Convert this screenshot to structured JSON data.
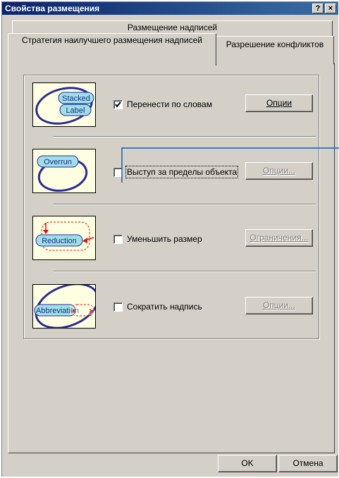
{
  "window": {
    "title": "Свойства размещения",
    "help_button": "?",
    "close_button": "×"
  },
  "tabs": {
    "back_row": [
      "Размещение надписей"
    ],
    "front_row": [
      "Стратегия наилучшего размещения надписей",
      "Разрешение конфликтов"
    ],
    "active": "Стратегия наилучшего размещения надписей"
  },
  "options": [
    {
      "illustration": [
        "Stacked",
        "Label"
      ],
      "checkbox_label": "Перенести по словам",
      "checked": true,
      "button_label": "Опции",
      "button_enabled": true
    },
    {
      "illustration": [
        "Overrun"
      ],
      "checkbox_label": "Выступ за пределы объекта",
      "checked": false,
      "button_label": "Опции...",
      "button_enabled": false
    },
    {
      "illustration": [
        "Reduction"
      ],
      "checkbox_label": "Уменьшить размер",
      "checked": false,
      "button_label": "Ограничения...",
      "button_enabled": false
    },
    {
      "illustration": [
        "Abbreviation"
      ],
      "checkbox_label": "Сократить надпись",
      "checked": false,
      "button_label": "Опции...",
      "button_enabled": false
    }
  ],
  "footer": {
    "ok_label": "OK",
    "cancel_label": "Отмена"
  },
  "colors": {
    "title_bar": "#0a246a",
    "face": "#d4d0c8",
    "illustration_bg": "#ffffe1",
    "ellipse_stroke": "#2a2a9a",
    "label_fill": "#9fe0e8",
    "arrow_red": "#dd1010",
    "callout_line": "#1060b0"
  }
}
